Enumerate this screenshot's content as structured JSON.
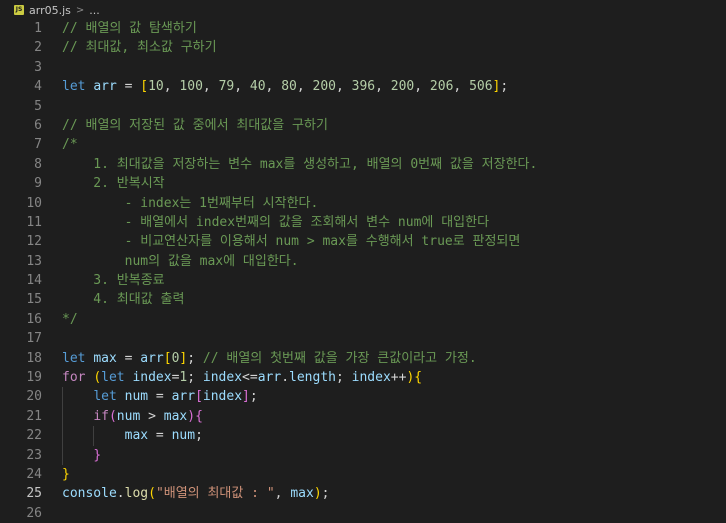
{
  "breadcrumb": {
    "file_badge": "JS",
    "file_name": "arr05.js",
    "separator": ">",
    "more": "..."
  },
  "active_line": 25,
  "colors": {
    "background": "#1e1e1e",
    "comment": "#6a9955",
    "keyword": "#569cd6",
    "control": "#c586c0",
    "variable": "#9cdcfe",
    "number": "#b5cea8",
    "string": "#ce9178",
    "function": "#dcdcaa",
    "bracket_level1": "#ffd700",
    "bracket_level2": "#da70d6",
    "bracket_level3": "#179fff"
  },
  "lines": [
    {
      "n": "1",
      "tokens": [
        {
          "t": "// 배열의 값 탐색하기",
          "c": "comment"
        }
      ]
    },
    {
      "n": "2",
      "tokens": [
        {
          "t": "// 최대값, 최소값 구하기",
          "c": "comment"
        }
      ]
    },
    {
      "n": "3",
      "tokens": []
    },
    {
      "n": "4",
      "tokens": [
        {
          "t": "let ",
          "c": "kw"
        },
        {
          "t": "arr",
          "c": "var"
        },
        {
          "t": " = ",
          "c": "plain"
        },
        {
          "t": "[",
          "c": "br1"
        },
        {
          "t": "10",
          "c": "num"
        },
        {
          "t": ", ",
          "c": "plain"
        },
        {
          "t": "100",
          "c": "num"
        },
        {
          "t": ", ",
          "c": "plain"
        },
        {
          "t": "79",
          "c": "num"
        },
        {
          "t": ", ",
          "c": "plain"
        },
        {
          "t": "40",
          "c": "num"
        },
        {
          "t": ", ",
          "c": "plain"
        },
        {
          "t": "80",
          "c": "num"
        },
        {
          "t": ", ",
          "c": "plain"
        },
        {
          "t": "200",
          "c": "num"
        },
        {
          "t": ", ",
          "c": "plain"
        },
        {
          "t": "396",
          "c": "num"
        },
        {
          "t": ", ",
          "c": "plain"
        },
        {
          "t": "200",
          "c": "num"
        },
        {
          "t": ", ",
          "c": "plain"
        },
        {
          "t": "206",
          "c": "num"
        },
        {
          "t": ", ",
          "c": "plain"
        },
        {
          "t": "506",
          "c": "num"
        },
        {
          "t": "]",
          "c": "br1"
        },
        {
          "t": ";",
          "c": "plain"
        }
      ]
    },
    {
      "n": "5",
      "tokens": []
    },
    {
      "n": "6",
      "tokens": [
        {
          "t": "// 배열의 저장된 값 중에서 최대값을 구하기",
          "c": "comment"
        }
      ]
    },
    {
      "n": "7",
      "tokens": [
        {
          "t": "/*",
          "c": "comment"
        }
      ]
    },
    {
      "n": "8",
      "tokens": [
        {
          "t": "    1. 최대값을 저장하는 변수 max를 생성하고, 배열의 0번째 값을 저장한다.",
          "c": "comment"
        }
      ]
    },
    {
      "n": "9",
      "tokens": [
        {
          "t": "    2. 반복시작",
          "c": "comment"
        }
      ]
    },
    {
      "n": "10",
      "tokens": [
        {
          "t": "        - index는 1번째부터 시작한다.",
          "c": "comment"
        }
      ]
    },
    {
      "n": "11",
      "tokens": [
        {
          "t": "        - 배열에서 index번째의 값을 조회해서 변수 num에 대입한다",
          "c": "comment"
        }
      ]
    },
    {
      "n": "12",
      "tokens": [
        {
          "t": "        - 비교연산자를 이용해서 num > max를 수행해서 true로 판정되면",
          "c": "comment"
        }
      ]
    },
    {
      "n": "13",
      "tokens": [
        {
          "t": "        num의 값을 max에 대입한다.",
          "c": "comment"
        }
      ]
    },
    {
      "n": "14",
      "tokens": [
        {
          "t": "    3. 반복종료",
          "c": "comment"
        }
      ]
    },
    {
      "n": "15",
      "tokens": [
        {
          "t": "    4. 최대값 출력",
          "c": "comment"
        }
      ]
    },
    {
      "n": "16",
      "tokens": [
        {
          "t": "*/",
          "c": "comment"
        }
      ]
    },
    {
      "n": "17",
      "tokens": []
    },
    {
      "n": "18",
      "tokens": [
        {
          "t": "let ",
          "c": "kw"
        },
        {
          "t": "max",
          "c": "var"
        },
        {
          "t": " = ",
          "c": "plain"
        },
        {
          "t": "arr",
          "c": "var"
        },
        {
          "t": "[",
          "c": "br1"
        },
        {
          "t": "0",
          "c": "num"
        },
        {
          "t": "]",
          "c": "br1"
        },
        {
          "t": "; ",
          "c": "plain"
        },
        {
          "t": "// 배열의 첫번째 값을 가장 큰값이라고 가정.",
          "c": "comment"
        }
      ]
    },
    {
      "n": "19",
      "tokens": [
        {
          "t": "for",
          "c": "ctrl"
        },
        {
          "t": " ",
          "c": "plain"
        },
        {
          "t": "(",
          "c": "br1"
        },
        {
          "t": "let ",
          "c": "kw"
        },
        {
          "t": "index",
          "c": "var"
        },
        {
          "t": "=",
          "c": "plain"
        },
        {
          "t": "1",
          "c": "num"
        },
        {
          "t": "; ",
          "c": "plain"
        },
        {
          "t": "index",
          "c": "var"
        },
        {
          "t": "<=",
          "c": "plain"
        },
        {
          "t": "arr",
          "c": "var"
        },
        {
          "t": ".",
          "c": "plain"
        },
        {
          "t": "length",
          "c": "var"
        },
        {
          "t": "; ",
          "c": "plain"
        },
        {
          "t": "index",
          "c": "var"
        },
        {
          "t": "++",
          "c": "plain"
        },
        {
          "t": ")",
          "c": "br1"
        },
        {
          "t": "{",
          "c": "br1"
        }
      ]
    },
    {
      "n": "20",
      "tokens": [
        {
          "t": "    ",
          "c": "plain"
        },
        {
          "t": "let ",
          "c": "kw"
        },
        {
          "t": "num",
          "c": "var"
        },
        {
          "t": " = ",
          "c": "plain"
        },
        {
          "t": "arr",
          "c": "var"
        },
        {
          "t": "[",
          "c": "br2"
        },
        {
          "t": "index",
          "c": "var"
        },
        {
          "t": "]",
          "c": "br2"
        },
        {
          "t": ";",
          "c": "plain"
        }
      ]
    },
    {
      "n": "21",
      "tokens": [
        {
          "t": "    ",
          "c": "plain"
        },
        {
          "t": "if",
          "c": "ctrl"
        },
        {
          "t": "(",
          "c": "br2"
        },
        {
          "t": "num",
          "c": "var"
        },
        {
          "t": " > ",
          "c": "plain"
        },
        {
          "t": "max",
          "c": "var"
        },
        {
          "t": ")",
          "c": "br2"
        },
        {
          "t": "{",
          "c": "br2"
        }
      ]
    },
    {
      "n": "22",
      "tokens": [
        {
          "t": "        ",
          "c": "plain"
        },
        {
          "t": "max",
          "c": "var"
        },
        {
          "t": " = ",
          "c": "plain"
        },
        {
          "t": "num",
          "c": "var"
        },
        {
          "t": ";",
          "c": "plain"
        }
      ]
    },
    {
      "n": "23",
      "tokens": [
        {
          "t": "    ",
          "c": "plain"
        },
        {
          "t": "}",
          "c": "br2"
        }
      ]
    },
    {
      "n": "24",
      "tokens": [
        {
          "t": "}",
          "c": "br1"
        }
      ]
    },
    {
      "n": "25",
      "tokens": [
        {
          "t": "console",
          "c": "var"
        },
        {
          "t": ".",
          "c": "plain"
        },
        {
          "t": "log",
          "c": "fn"
        },
        {
          "t": "(",
          "c": "br1"
        },
        {
          "t": "\"배열의 최대값 : \"",
          "c": "str"
        },
        {
          "t": ", ",
          "c": "plain"
        },
        {
          "t": "max",
          "c": "var"
        },
        {
          "t": ")",
          "c": "br1"
        },
        {
          "t": ";",
          "c": "plain"
        }
      ]
    },
    {
      "n": "26",
      "tokens": []
    }
  ]
}
